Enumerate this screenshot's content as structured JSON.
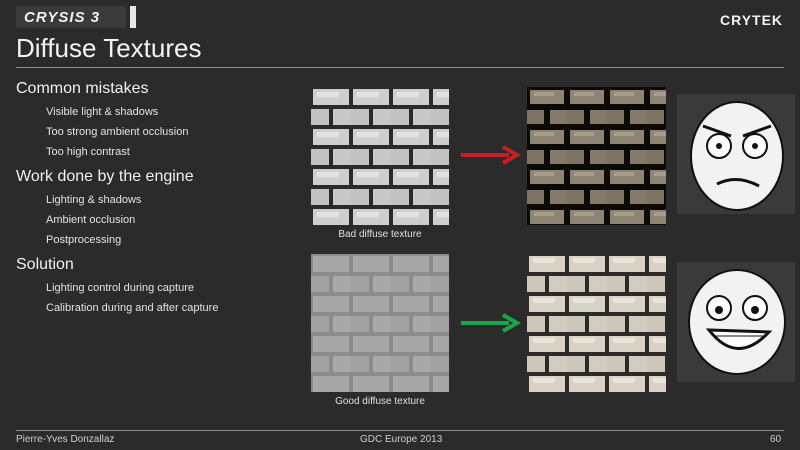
{
  "header": {
    "game_logo_text": "CRYSIS 3",
    "company_logo_text": "CRYTEK"
  },
  "slide": {
    "title": "Diffuse Textures",
    "sections": [
      {
        "heading": "Common mistakes",
        "items": [
          "Visible light & shadows",
          "Too strong ambient occlusion",
          "Too high contrast"
        ]
      },
      {
        "heading": "Work done by the engine",
        "items": [
          "Lighting & shadows",
          "Ambient occlusion",
          "Postprocessing"
        ]
      },
      {
        "heading": "Solution",
        "items": [
          "Lighting control during capture",
          "Calibration during and after capture"
        ]
      }
    ],
    "bad_caption": "Bad diffuse texture",
    "good_caption": "Good diffuse texture",
    "bad_arrow_color": "#c42020",
    "good_arrow_color": "#18a84a"
  },
  "footer": {
    "author": "Pierre-Yves Donzallaz",
    "event": "GDC Europe 2013",
    "page": "60"
  }
}
